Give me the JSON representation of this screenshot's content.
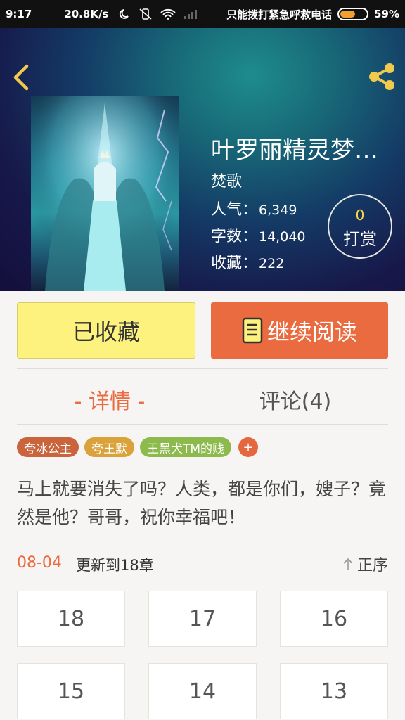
{
  "status_bar": {
    "time": "9:17",
    "speed": "20.8K/s",
    "carrier_text": "只能拨打紧急呼救电话",
    "battery_percent": "59%",
    "battery_level": 0.59
  },
  "header": {
    "back_icon": "chevron-left-icon",
    "share_icon": "share-icon",
    "accent_color": "#f2c94c"
  },
  "book": {
    "title": "叶罗丽精灵梦…",
    "author": "焚歌",
    "stats": [
      {
        "label": "人气：",
        "value": "6,349"
      },
      {
        "label": "字数：",
        "value": "14,040"
      },
      {
        "label": "收藏：",
        "value": "222"
      }
    ],
    "tip_count": "0",
    "tip_label": "打赏"
  },
  "actions": {
    "favorite_label": "已收藏",
    "read_label": "继续阅读",
    "favorite_color": "#fdf27d",
    "read_color": "#ea6b3f"
  },
  "tabs": [
    {
      "label": "- 详情 -",
      "active": true
    },
    {
      "label": "评论(4)",
      "active": false
    }
  ],
  "tags": [
    {
      "label": "夸冰公主",
      "color": "#c9643c"
    },
    {
      "label": "夸王默",
      "color": "#d9a23a"
    },
    {
      "label": "王黑犬TM的贱",
      "color": "#8dba4c"
    }
  ],
  "tag_add_label": "+",
  "intro": "马上就要消失了吗？人类，都是你们，嫂子？竟然是他？哥哥，祝你幸福吧！",
  "update": {
    "date": "08-04",
    "text": "更新到18章",
    "sort_label": "正序"
  },
  "chapters": [
    "18",
    "17",
    "16",
    "15",
    "14",
    "13"
  ]
}
